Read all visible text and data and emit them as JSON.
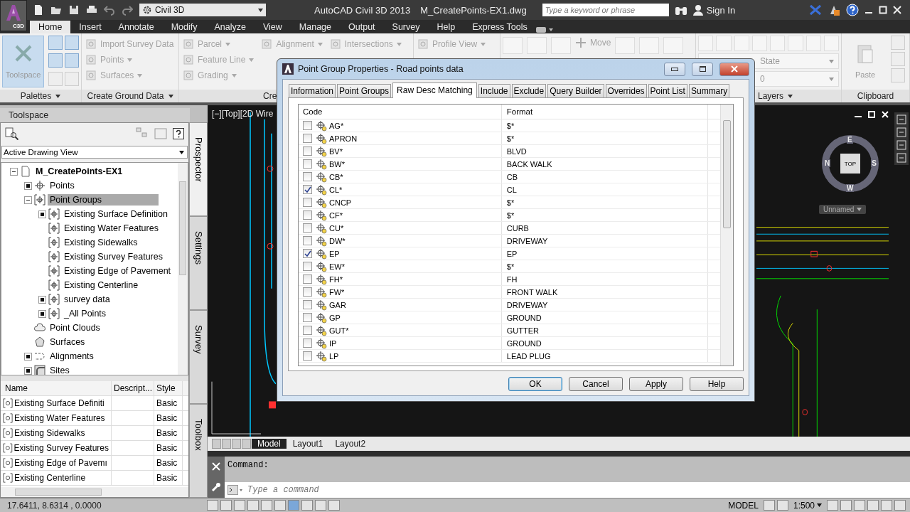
{
  "titlebar": {
    "app_badge": "C3D",
    "workspace": "Civil 3D",
    "title": "AutoCAD Civil 3D 2013",
    "file": "M_CreatePoints-EX1.dwg",
    "search": {
      "placeholder": "Type a keyword or phrase"
    },
    "sign_in": "Sign In"
  },
  "ribbon_tabs": [
    {
      "label": "Home",
      "selected": true
    },
    {
      "label": "Insert",
      "selected": false
    },
    {
      "label": "Annotate",
      "selected": false
    },
    {
      "label": "Modify",
      "selected": false
    },
    {
      "label": "Analyze",
      "selected": false
    },
    {
      "label": "View",
      "selected": false
    },
    {
      "label": "Manage",
      "selected": false
    },
    {
      "label": "Output",
      "selected": false
    },
    {
      "label": "Survey",
      "selected": false
    },
    {
      "label": "Help",
      "selected": false
    },
    {
      "label": "Express Tools",
      "selected": false
    }
  ],
  "ribbon_panels": [
    {
      "title": "Palettes",
      "kind": "big",
      "items": [
        "Toolspace"
      ]
    },
    {
      "title": "Create Ground Data",
      "kind": "columns",
      "columns": [
        [
          "Import Survey Data",
          "Points",
          "Surfaces"
        ]
      ]
    },
    {
      "title": "Cre",
      "kind": "columns",
      "columns": [
        [
          "Parcel",
          "Feature Line",
          "Grading"
        ],
        [
          "Alignment"
        ],
        [
          "Intersections"
        ]
      ]
    },
    {
      "kind": "columns",
      "columns": [
        [
          "Profile View"
        ]
      ]
    },
    {
      "kind": "tools",
      "items": [
        "Move"
      ]
    },
    {
      "title": "Layers",
      "kind": "combo",
      "items": [
        "State",
        "0"
      ]
    },
    {
      "title": "Clipboard",
      "kind": "big",
      "items": [
        "Paste"
      ]
    }
  ],
  "toolspace": {
    "title": "Toolspace",
    "view": "Active Drawing View",
    "tree": [
      {
        "label": "M_CreatePoints-EX1",
        "kind": "drawing",
        "expanded": true,
        "selected": false,
        "children": [
          {
            "label": "Points",
            "kind": "points",
            "expanded": false,
            "selected": false
          },
          {
            "label": "Point Groups",
            "kind": "group",
            "expanded": true,
            "selected": true,
            "children": [
              {
                "label": "Existing Surface Definition",
                "kind": "group",
                "expanded": false,
                "selected": false
              },
              {
                "label": "Existing Water Features",
                "kind": "group",
                "selected": false
              },
              {
                "label": "Existing Sidewalks",
                "kind": "group",
                "selected": false
              },
              {
                "label": "Existing Survey Features",
                "kind": "group",
                "selected": false
              },
              {
                "label": "Existing Edge of Pavement",
                "kind": "group",
                "selected": false
              },
              {
                "label": "Existing Centerline",
                "kind": "group",
                "selected": false
              },
              {
                "label": "survey data",
                "kind": "group",
                "expanded": false,
                "selected": false
              },
              {
                "label": "_All Points",
                "kind": "group",
                "expanded": false,
                "selected": false
              }
            ]
          },
          {
            "label": "Point Clouds",
            "kind": "cloud",
            "selected": false
          },
          {
            "label": "Surfaces",
            "kind": "surface",
            "selected": false
          },
          {
            "label": "Alignments",
            "kind": "alignment",
            "expanded": false,
            "selected": false
          },
          {
            "label": "Sites",
            "kind": "site",
            "expanded": false,
            "selected": false
          }
        ]
      }
    ],
    "side_tabs": [
      {
        "label": "Prospector",
        "selected": true
      },
      {
        "label": "Settings",
        "selected": false
      },
      {
        "label": "Survey",
        "selected": false
      },
      {
        "label": "Toolbox",
        "selected": false
      }
    ],
    "list": {
      "columns": [
        "Name",
        "Descript...",
        "Style"
      ],
      "rows": [
        [
          "Existing Surface Definiti",
          "",
          "Basic"
        ],
        [
          "Existing Water Features",
          "",
          "Basic"
        ],
        [
          "Existing Sidewalks",
          "",
          "Basic"
        ],
        [
          "Existing Survey Features",
          "",
          "Basic"
        ],
        [
          "Existing Edge of Pavemı",
          "",
          "Basic"
        ],
        [
          "Existing Centerline",
          "",
          "Basic"
        ]
      ]
    }
  },
  "viewport": {
    "label": "[−][Top][2D Wire",
    "viewcube": {
      "east": "E",
      "north": "N",
      "face": "TOP",
      "south": "S",
      "west": "W"
    },
    "ucs": "Unnamed"
  },
  "layout_tabs": [
    {
      "label": "Model",
      "selected": true
    },
    {
      "label": "Layout1",
      "selected": false
    },
    {
      "label": "Layout2",
      "selected": false
    }
  ],
  "command": {
    "history": "Command:",
    "placeholder": "Type a command"
  },
  "status_bar": {
    "coordinates": "17.6411, 8.6314 , 0.0000",
    "space": "MODEL",
    "scale": "1:500"
  },
  "dialog": {
    "title": "Point Group Properties - Road points data",
    "tabs": [
      {
        "label": "Information",
        "selected": false
      },
      {
        "label": "Point Groups",
        "selected": false
      },
      {
        "label": "Raw Desc Matching",
        "selected": true
      },
      {
        "label": "Include",
        "selected": false
      },
      {
        "label": "Exclude",
        "selected": false
      },
      {
        "label": "Query Builder",
        "selected": false
      },
      {
        "label": "Overrides",
        "selected": false
      },
      {
        "label": "Point List",
        "selected": false
      },
      {
        "label": "Summary",
        "selected": false
      }
    ],
    "columns": [
      "Code",
      "Format"
    ],
    "rows": [
      {
        "code": "AG*",
        "format": "$*",
        "checked": false
      },
      {
        "code": "APRON",
        "format": "$*",
        "checked": false
      },
      {
        "code": "BV*",
        "format": "BLVD",
        "checked": false
      },
      {
        "code": "BW*",
        "format": "BACK WALK",
        "checked": false
      },
      {
        "code": "CB*",
        "format": "CB",
        "checked": false
      },
      {
        "code": "CL*",
        "format": "CL",
        "checked": true
      },
      {
        "code": "CNCP",
        "format": "$*",
        "checked": false
      },
      {
        "code": "CF*",
        "format": "$*",
        "checked": false
      },
      {
        "code": "CU*",
        "format": "CURB",
        "checked": false
      },
      {
        "code": "DW*",
        "format": "DRIVEWAY",
        "checked": false
      },
      {
        "code": "EP",
        "format": "EP",
        "checked": true
      },
      {
        "code": "EW*",
        "format": "$*",
        "checked": false
      },
      {
        "code": "FH*",
        "format": "FH",
        "checked": false
      },
      {
        "code": "FW*",
        "format": "FRONT WALK",
        "checked": false
      },
      {
        "code": "GAR",
        "format": "DRIVEWAY",
        "checked": false
      },
      {
        "code": "GP",
        "format": "GROUND",
        "checked": false
      },
      {
        "code": "GUT*",
        "format": "GUTTER",
        "checked": false
      },
      {
        "code": "IP",
        "format": "GROUND",
        "checked": false
      },
      {
        "code": "LP",
        "format": "LEAD PLUG",
        "checked": false
      }
    ],
    "buttons": [
      {
        "label": "OK",
        "default": true
      },
      {
        "label": "Cancel",
        "default": false
      },
      {
        "label": "Apply",
        "default": false
      },
      {
        "label": "Help",
        "default": false
      }
    ]
  }
}
